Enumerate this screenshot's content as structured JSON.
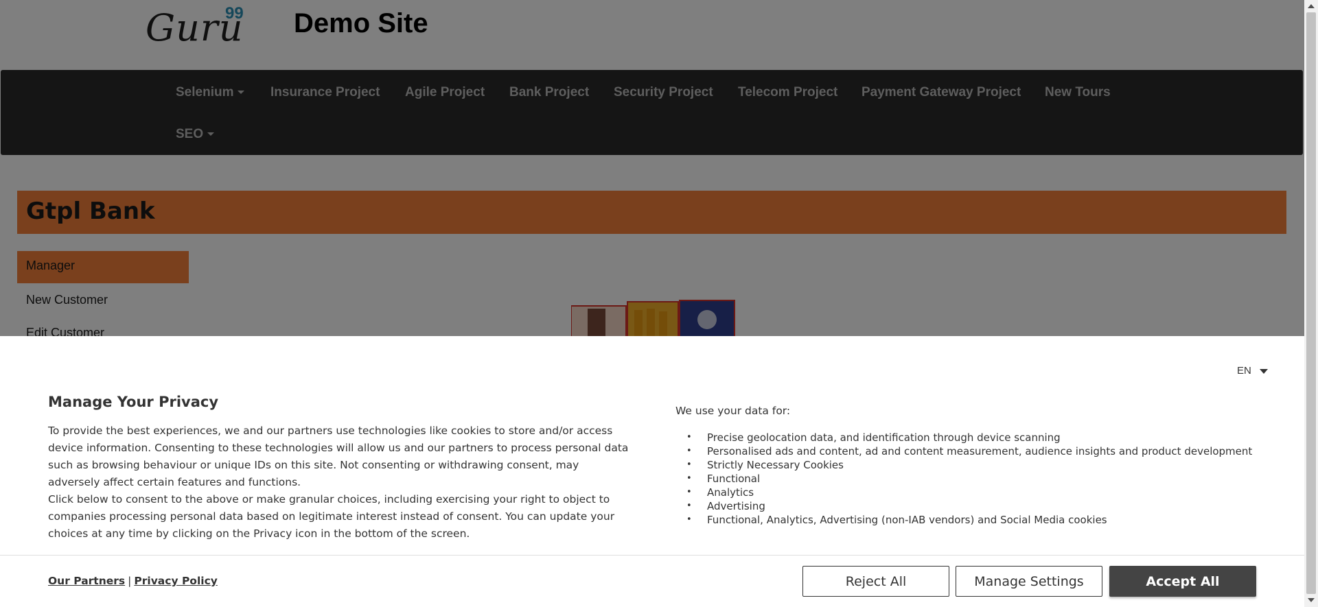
{
  "header": {
    "logo_text": "Guru",
    "logo_superscript": "99",
    "site_title": "Demo Site"
  },
  "nav": {
    "items": [
      {
        "label": "Selenium",
        "dropdown": true
      },
      {
        "label": "Insurance Project"
      },
      {
        "label": "Agile Project"
      },
      {
        "label": "Bank Project"
      },
      {
        "label": "Security Project"
      },
      {
        "label": "Telecom Project"
      },
      {
        "label": "Payment Gateway Project"
      },
      {
        "label": "New Tours"
      },
      {
        "label": "SEO",
        "dropdown": true
      }
    ]
  },
  "page": {
    "banner_title": "Gtpl Bank",
    "sidebar": [
      "Manager",
      "New Customer",
      "Edit Customer"
    ]
  },
  "consent": {
    "language": "EN",
    "title": "Manage Your Privacy",
    "paragraph1": "To provide the best experiences, we and our partners use technologies like cookies to store and/or access device information. Consenting to these technologies will allow us and our partners to process personal data such as browsing behaviour or unique IDs on this site. Not consenting or withdrawing consent, may adversely affect certain features and functions.",
    "paragraph2": "Click below to consent to the above or make granular choices, including exercising your right to object to companies processing personal data based on legitimate interest instead of consent. You can update your choices at any time by clicking on the Privacy icon in the bottom of the screen.",
    "uses_title": "We use your data for:",
    "uses": [
      "Precise geolocation data, and identification through device scanning",
      "Personalised ads and content, ad and content measurement, audience insights and product development",
      "Strictly Necessary Cookies",
      "Functional",
      "Analytics",
      "Advertising",
      "Functional, Analytics, Advertising (non-IAB vendors) and Social Media cookies"
    ],
    "partners_link": "Our Partners",
    "separator": "|",
    "privacy_link": "Privacy Policy",
    "reject_label": "Reject All",
    "manage_label": "Manage Settings",
    "accept_label": "Accept All"
  },
  "colors": {
    "accent_orange": "#f5813a",
    "navbar": "#2b2b2b",
    "accept_button": "#444444",
    "logo_superscript": "#2a8fb4"
  }
}
